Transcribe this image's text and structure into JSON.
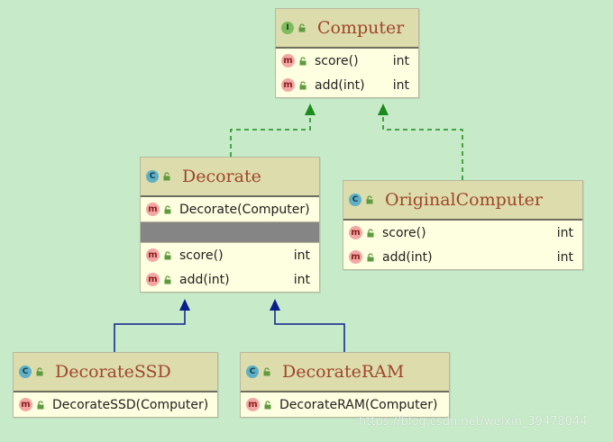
{
  "classes": {
    "computer": {
      "kind_letter": "I",
      "name": "Computer",
      "methods": [
        {
          "signature": "score()",
          "returns": "int"
        },
        {
          "signature": "add(int)",
          "returns": "int"
        }
      ]
    },
    "decorate": {
      "kind_letter": "C",
      "name": "Decorate",
      "constructor": "Decorate(Computer)",
      "methods": [
        {
          "signature": "score()",
          "returns": "int"
        },
        {
          "signature": "add(int)",
          "returns": "int"
        }
      ]
    },
    "original_computer": {
      "kind_letter": "C",
      "name": "OriginalComputer",
      "methods": [
        {
          "signature": "score()",
          "returns": "int"
        },
        {
          "signature": "add(int)",
          "returns": "int"
        }
      ]
    },
    "decorate_ssd": {
      "kind_letter": "C",
      "name": "DecorateSSD",
      "constructor": "DecorateSSD(Computer)"
    },
    "decorate_ram": {
      "kind_letter": "C",
      "name": "DecorateRAM",
      "constructor": "DecorateRAM(Computer)"
    }
  },
  "member_icon_letter": "m",
  "relations": [
    {
      "from": "Decorate",
      "to": "Computer",
      "type": "implements"
    },
    {
      "from": "OriginalComputer",
      "to": "Computer",
      "type": "implements"
    },
    {
      "from": "DecorateSSD",
      "to": "Decorate",
      "type": "extends"
    },
    {
      "from": "DecorateRAM",
      "to": "Decorate",
      "type": "extends"
    }
  ],
  "colors": {
    "background": "#c7ebc9",
    "implements_edge": "#1d8a1d",
    "extends_edge": "#0b1f8c",
    "class_name": "#a0462a"
  },
  "watermark": "https://blog.csdn.net/weixin_39478044"
}
